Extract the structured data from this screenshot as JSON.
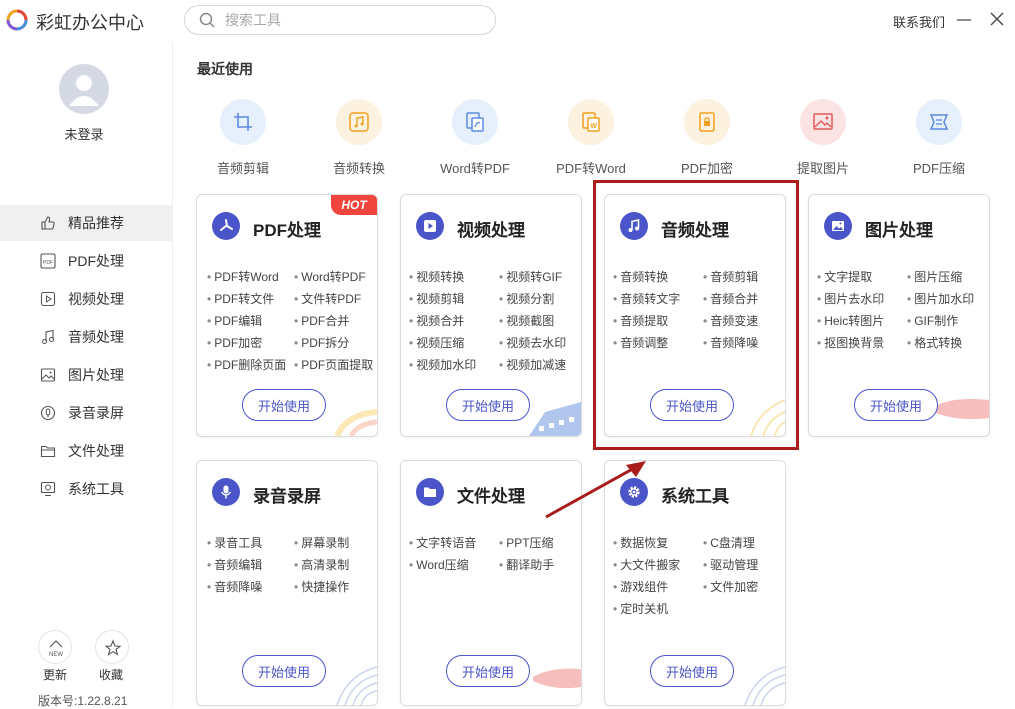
{
  "app": {
    "title": "彩虹办公中心",
    "contact": "联系我们"
  },
  "search": {
    "placeholder": "搜索工具"
  },
  "user": {
    "label": "未登录"
  },
  "sidebar": {
    "items": [
      {
        "label": "精品推荐",
        "icon": "thumbs-up-icon",
        "active": true
      },
      {
        "label": "PDF处理",
        "icon": "pdf-icon"
      },
      {
        "label": "视频处理",
        "icon": "video-icon"
      },
      {
        "label": "音频处理",
        "icon": "music-icon"
      },
      {
        "label": "图片处理",
        "icon": "image-icon"
      },
      {
        "label": "录音录屏",
        "icon": "record-icon"
      },
      {
        "label": "文件处理",
        "icon": "folder-icon"
      },
      {
        "label": "系统工具",
        "icon": "monitor-icon"
      }
    ],
    "update_label": "更新",
    "update_badge": "NEW",
    "favorite_label": "收藏",
    "version": "版本号:1.22.8.21"
  },
  "recent": {
    "title": "最近使用",
    "items": [
      {
        "label": "音频剪辑",
        "icon": "crop-icon",
        "color": "#5b8be0"
      },
      {
        "label": "音频转换",
        "icon": "music-convert-icon",
        "color": "#f0a020"
      },
      {
        "label": "Word转PDF",
        "icon": "word-to-pdf-icon",
        "color": "#5b8be0"
      },
      {
        "label": "PDF转Word",
        "icon": "pdf-to-word-icon",
        "color": "#f0a020"
      },
      {
        "label": "PDF加密",
        "icon": "lock-icon",
        "color": "#f0a020"
      },
      {
        "label": "提取图片",
        "icon": "extract-image-icon",
        "color": "#e05a5a"
      },
      {
        "label": "PDF压缩",
        "icon": "compress-icon",
        "color": "#5b8be0"
      }
    ]
  },
  "cards": [
    {
      "title": "PDF处理",
      "icon": "pdf-icon",
      "badge": "HOT",
      "features": [
        "PDF转Word",
        "Word转PDF",
        "PDF转文件",
        "文件转PDF",
        "PDF编辑",
        "PDF合并",
        "PDF加密",
        "PDF拆分",
        "PDF删除页面",
        "PDF页面提取"
      ]
    },
    {
      "title": "视频处理",
      "icon": "video-icon",
      "features": [
        "视频转换",
        "视频转GIF",
        "视频剪辑",
        "视频分割",
        "视频合并",
        "视频截图",
        "视频压缩",
        "视频去水印",
        "视频加水印",
        "视频加减速"
      ]
    },
    {
      "title": "音频处理",
      "icon": "music-icon",
      "features": [
        "音频转换",
        "音频剪辑",
        "音频转文字",
        "音频合并",
        "音频提取",
        "音频变速",
        "音频调整",
        "音频降噪"
      ]
    },
    {
      "title": "图片处理",
      "icon": "image-icon",
      "features": [
        "文字提取",
        "图片压缩",
        "图片去水印",
        "图片加水印",
        "Heic转图片",
        "GIF制作",
        "抠图换背景",
        "格式转换"
      ]
    },
    {
      "title": "录音录屏",
      "icon": "mic-icon",
      "features": [
        "录音工具",
        "屏幕录制",
        "音频编辑",
        "高清录制",
        "音频降噪",
        "快捷操作"
      ]
    },
    {
      "title": "文件处理",
      "icon": "folder-icon",
      "features": [
        "文字转语音",
        "PPT压缩",
        "Word压缩",
        "翻译助手"
      ]
    },
    {
      "title": "系统工具",
      "icon": "gear-icon",
      "features": [
        "数据恢复",
        "C盘清理",
        "大文件搬家",
        "驱动管理",
        "游戏组件",
        "文件加密",
        "定时关机"
      ]
    }
  ],
  "start_label": "开始使用",
  "colors": {
    "accent": "#4a55c9",
    "highlight": "#a81c1c",
    "hot": "#f0453c"
  }
}
